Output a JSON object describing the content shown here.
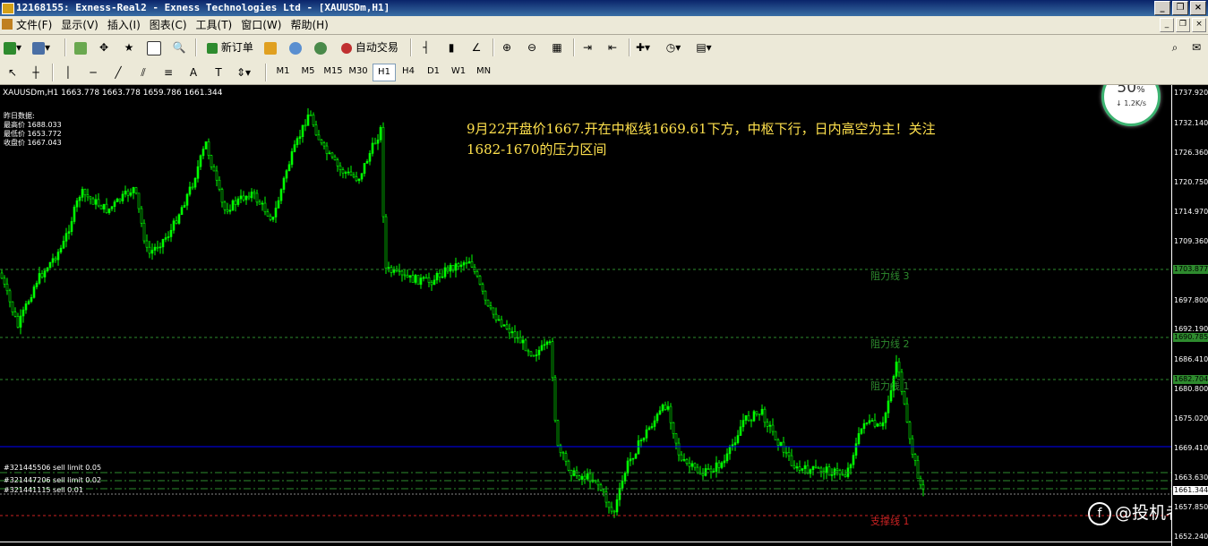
{
  "window": {
    "title": "12168155: Exness-Real2 - Exness Technologies Ltd - [XAUUSDm,H1]"
  },
  "menu": [
    "文件(F)",
    "显示(V)",
    "插入(I)",
    "图表(C)",
    "工具(T)",
    "窗口(W)",
    "帮助(H)"
  ],
  "toolbar": {
    "new_order": "新订单",
    "auto_trade": "自动交易"
  },
  "timeframes": [
    "M1",
    "M5",
    "M15",
    "M30",
    "H1",
    "H4",
    "D1",
    "W1",
    "MN"
  ],
  "active_timeframe": "H1",
  "chart": {
    "symbol_line": "XAUUSDm,H1  1663.778 1663.778 1659.786 1661.344",
    "yesterday": [
      "昨日数据:",
      "最高价 1688.033",
      "最低价 1653.772",
      "收盘价 1667.043"
    ],
    "annotation": [
      "9月22开盘价1667.开在中枢线1669.61下方，中枢下行，日内高空为主！关注",
      "1682-1670的压力区间"
    ],
    "price_labels": [
      "1737.920",
      "1732.140",
      "1726.360",
      "1720.750",
      "1714.970",
      "1709.360",
      "1697.800",
      "1692.190",
      "1686.410",
      "1680.800",
      "1675.020",
      "1669.410",
      "1663.630",
      "1657.850",
      "1652.240"
    ],
    "tags": [
      "1703.877",
      "1690.785",
      "1682.704",
      "1661.344"
    ],
    "levels": [
      {
        "label": "阻力线 3",
        "color": "#2e8b2e"
      },
      {
        "label": "阻力线 2",
        "color": "#2e8b2e"
      },
      {
        "label": "阻力线 1",
        "color": "#2e8b2e"
      },
      {
        "label": "支撑线 1",
        "color": "#cc2222"
      }
    ],
    "orders": [
      "#321445506 sell limit 0.05",
      "#321447206 sell limit 0.02",
      "#321441115 sell 0.01"
    ],
    "colors": {
      "candle": "#00ff00",
      "resistance": "#2e8b2e",
      "support": "#cc2222",
      "pivot": "#0000ff",
      "annotation": "#ffe14d"
    }
  },
  "speed_widget": {
    "percent": "50",
    "unit": "%",
    "rate": "1.2K/s"
  },
  "watermark": "@投机者"
}
